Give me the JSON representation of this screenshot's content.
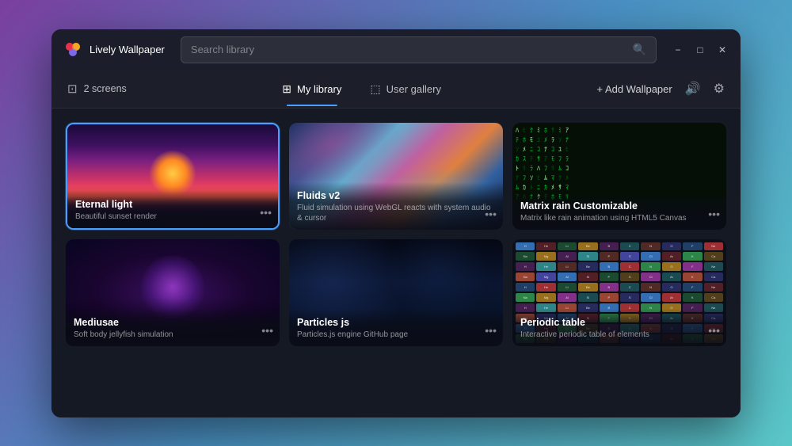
{
  "app": {
    "title": "Lively Wallpaper",
    "logo_unicode": "⬡"
  },
  "titlebar": {
    "search_placeholder": "Search library",
    "minimize_label": "−",
    "maximize_label": "□",
    "close_label": "✕"
  },
  "toolbar": {
    "screens_count": "2 screens",
    "tab_library_label": "My library",
    "tab_gallery_label": "User gallery",
    "add_wallpaper_label": "+ Add Wallpaper"
  },
  "wallpapers": [
    {
      "id": "eternal-light",
      "title": "Eternal light",
      "description": "Beautiful sunset render",
      "selected": true,
      "thumb_class": "thumb-eternal"
    },
    {
      "id": "fluids-v2",
      "title": "Fluids v2",
      "description": "Fluid simulation using WebGL reacts with system audio & cursor",
      "selected": false,
      "thumb_class": "thumb-fluids"
    },
    {
      "id": "matrix-rain",
      "title": "Matrix rain Customizable",
      "description": "Matrix like rain animation using HTML5 Canvas",
      "selected": false,
      "thumb_class": "thumb-matrix"
    },
    {
      "id": "jellyfish",
      "title": "Mediusae",
      "description": "Soft body jellyfish simulation",
      "selected": false,
      "thumb_class": "thumb-jellyfish"
    },
    {
      "id": "particlejs",
      "title": "Particles js",
      "description": "Particles.js engine GitHub page",
      "selected": false,
      "thumb_class": "thumb-particle"
    },
    {
      "id": "periodic-table",
      "title": "Periodic table",
      "description": "Interactive periodic table of elements",
      "selected": false,
      "thumb_class": "thumb-periodic"
    }
  ]
}
